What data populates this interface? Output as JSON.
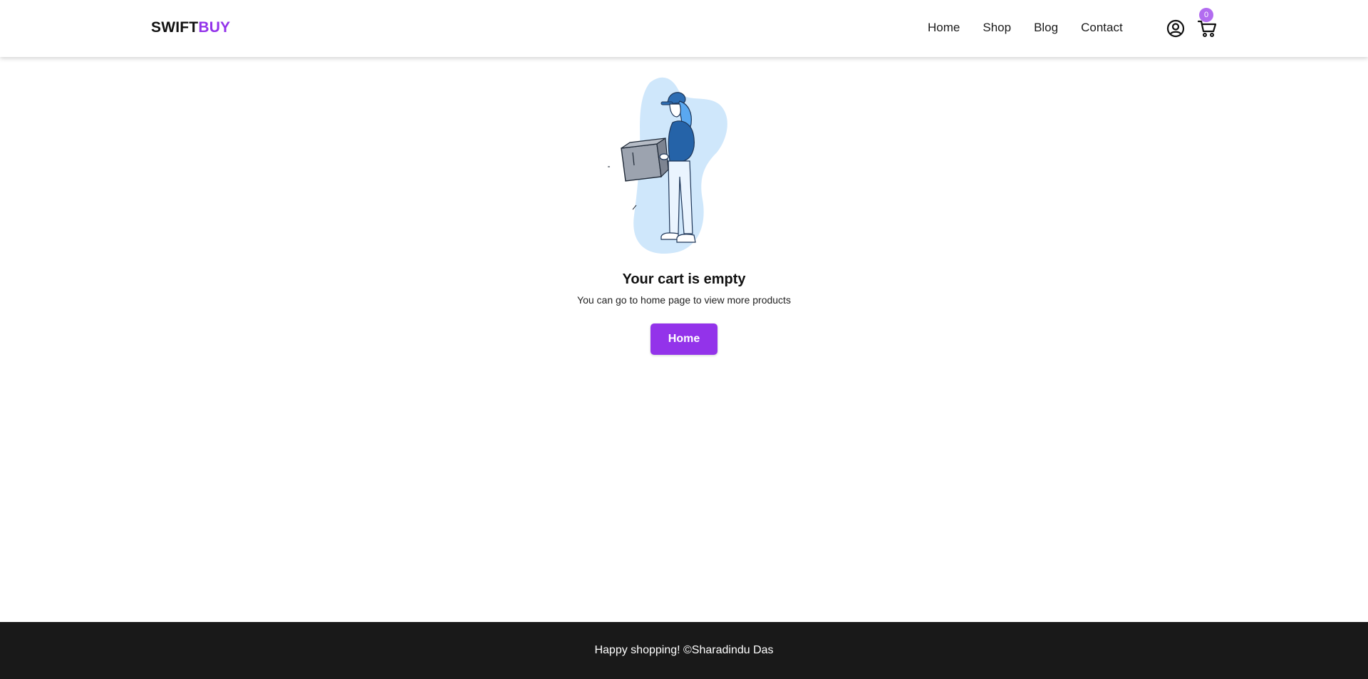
{
  "brand": {
    "part1": "SWIFT",
    "part2": "BUY",
    "accent_color": "#9333ea"
  },
  "nav": {
    "links": [
      {
        "label": "Home"
      },
      {
        "label": "Shop"
      },
      {
        "label": "Blog"
      },
      {
        "label": "Contact"
      }
    ],
    "account_icon": "user-circle-icon",
    "cart_icon": "shopping-cart-icon",
    "cart_count": "0",
    "cart_badge_color": "#b26cf0"
  },
  "empty_cart": {
    "illustration": "delivery-person-holding-box",
    "title": "Your cart is empty",
    "subtitle": "You can go to home page to view more products",
    "button_label": "Home",
    "button_color": "#9333ea"
  },
  "footer": {
    "text": "Happy shopping! ©Sharadindu Das",
    "background": "#191919"
  }
}
